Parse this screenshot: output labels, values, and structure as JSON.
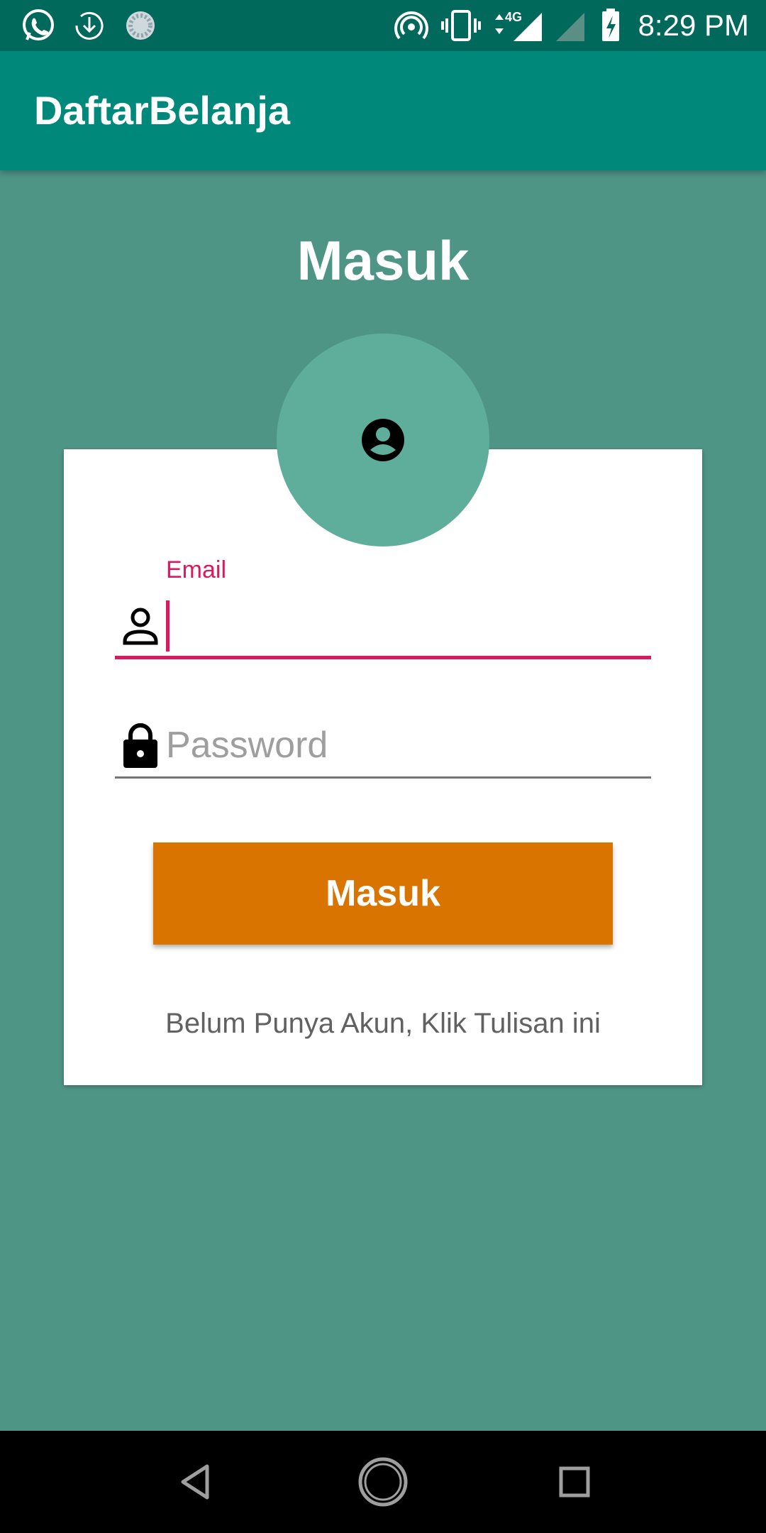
{
  "status_bar": {
    "time": "8:29 PM",
    "icons": [
      "whatsapp-icon",
      "download-icon",
      "loading-icon",
      "hotspot-icon",
      "vibrate-icon",
      "4g-signal-icon",
      "signal-icon",
      "battery-charging-icon"
    ],
    "network_label": "4G"
  },
  "app_bar": {
    "title": "DaftarBelanja"
  },
  "page": {
    "title": "Masuk"
  },
  "form": {
    "email_label": "Email",
    "email_value": "",
    "password_placeholder": "Password",
    "submit_label": "Masuk",
    "register_text": "Belum Punya Akun, Klik Tulisan ini"
  },
  "colors": {
    "status_bar": "#00695c",
    "app_bar": "#00897b",
    "background": "#4f9585",
    "accent": "#d81b60",
    "button": "#d97400",
    "avatar": "#5fae9c"
  },
  "nav_bar": {
    "buttons": [
      "back-icon",
      "home-icon",
      "recents-icon"
    ]
  }
}
